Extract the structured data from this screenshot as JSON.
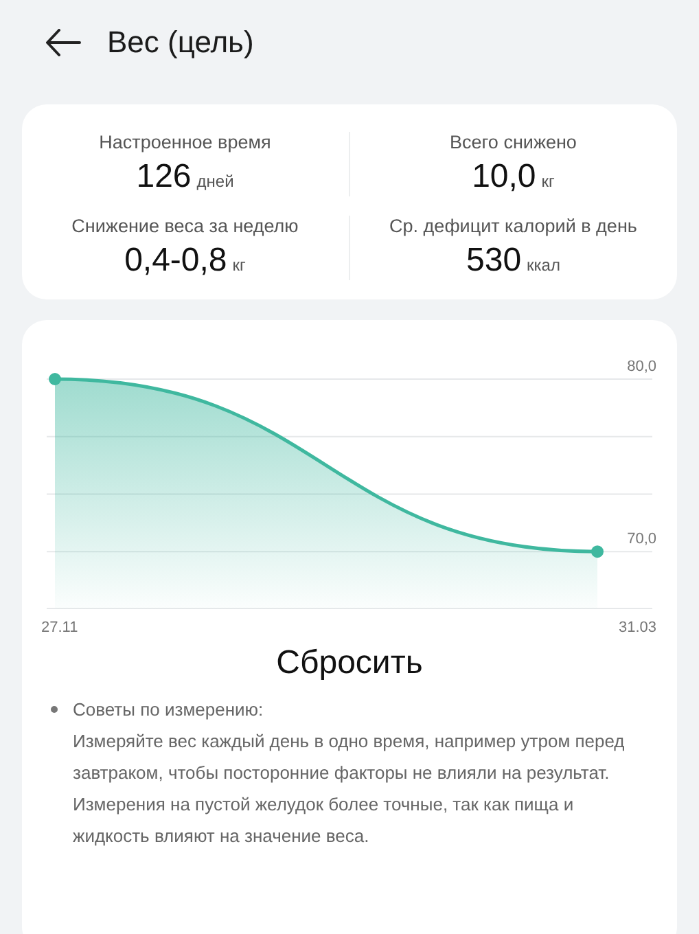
{
  "header": {
    "title": "Вес (цель)"
  },
  "stats": [
    {
      "label": "Настроенное время",
      "value": "126",
      "unit": "дней"
    },
    {
      "label": "Всего снижено",
      "value": "10,0",
      "unit": "кг"
    },
    {
      "label": "Снижение веса за неделю",
      "value": "0,4-0,8",
      "unit": "кг"
    },
    {
      "label": "Ср. дефицит калорий в день",
      "value": "530",
      "unit": "ккал"
    }
  ],
  "chart": {
    "chart_data": {
      "type": "area",
      "categories": [
        "27.11",
        "31.03"
      ],
      "series": [
        {
          "color": "#3fb89f",
          "values": [
            80,
            70
          ]
        }
      ],
      "ylim": [
        66.7,
        80
      ],
      "ref_lines": [
        {
          "axis": "y",
          "value": 80
        },
        {
          "axis": "y",
          "value": 76.67
        },
        {
          "axis": "y",
          "value": 73.33
        },
        {
          "axis": "y",
          "value": 70
        },
        {
          "axis": "y",
          "value": 66.7
        }
      ],
      "yticks": [
        {
          "value": 80,
          "label": "80,0"
        },
        {
          "value": 70,
          "label": "70,0"
        }
      ]
    }
  },
  "reset_button": {
    "label": "Сбросить"
  },
  "tips": [
    {
      "text": "Советы по измерению:\nИзмеряйте вес каждый день в одно время, например утром перед завтраком, чтобы посторонние факторы не влияли на результат. Измерения на пустой желудок более точные, так как пища и жидкость влияют на значение веса."
    }
  ]
}
